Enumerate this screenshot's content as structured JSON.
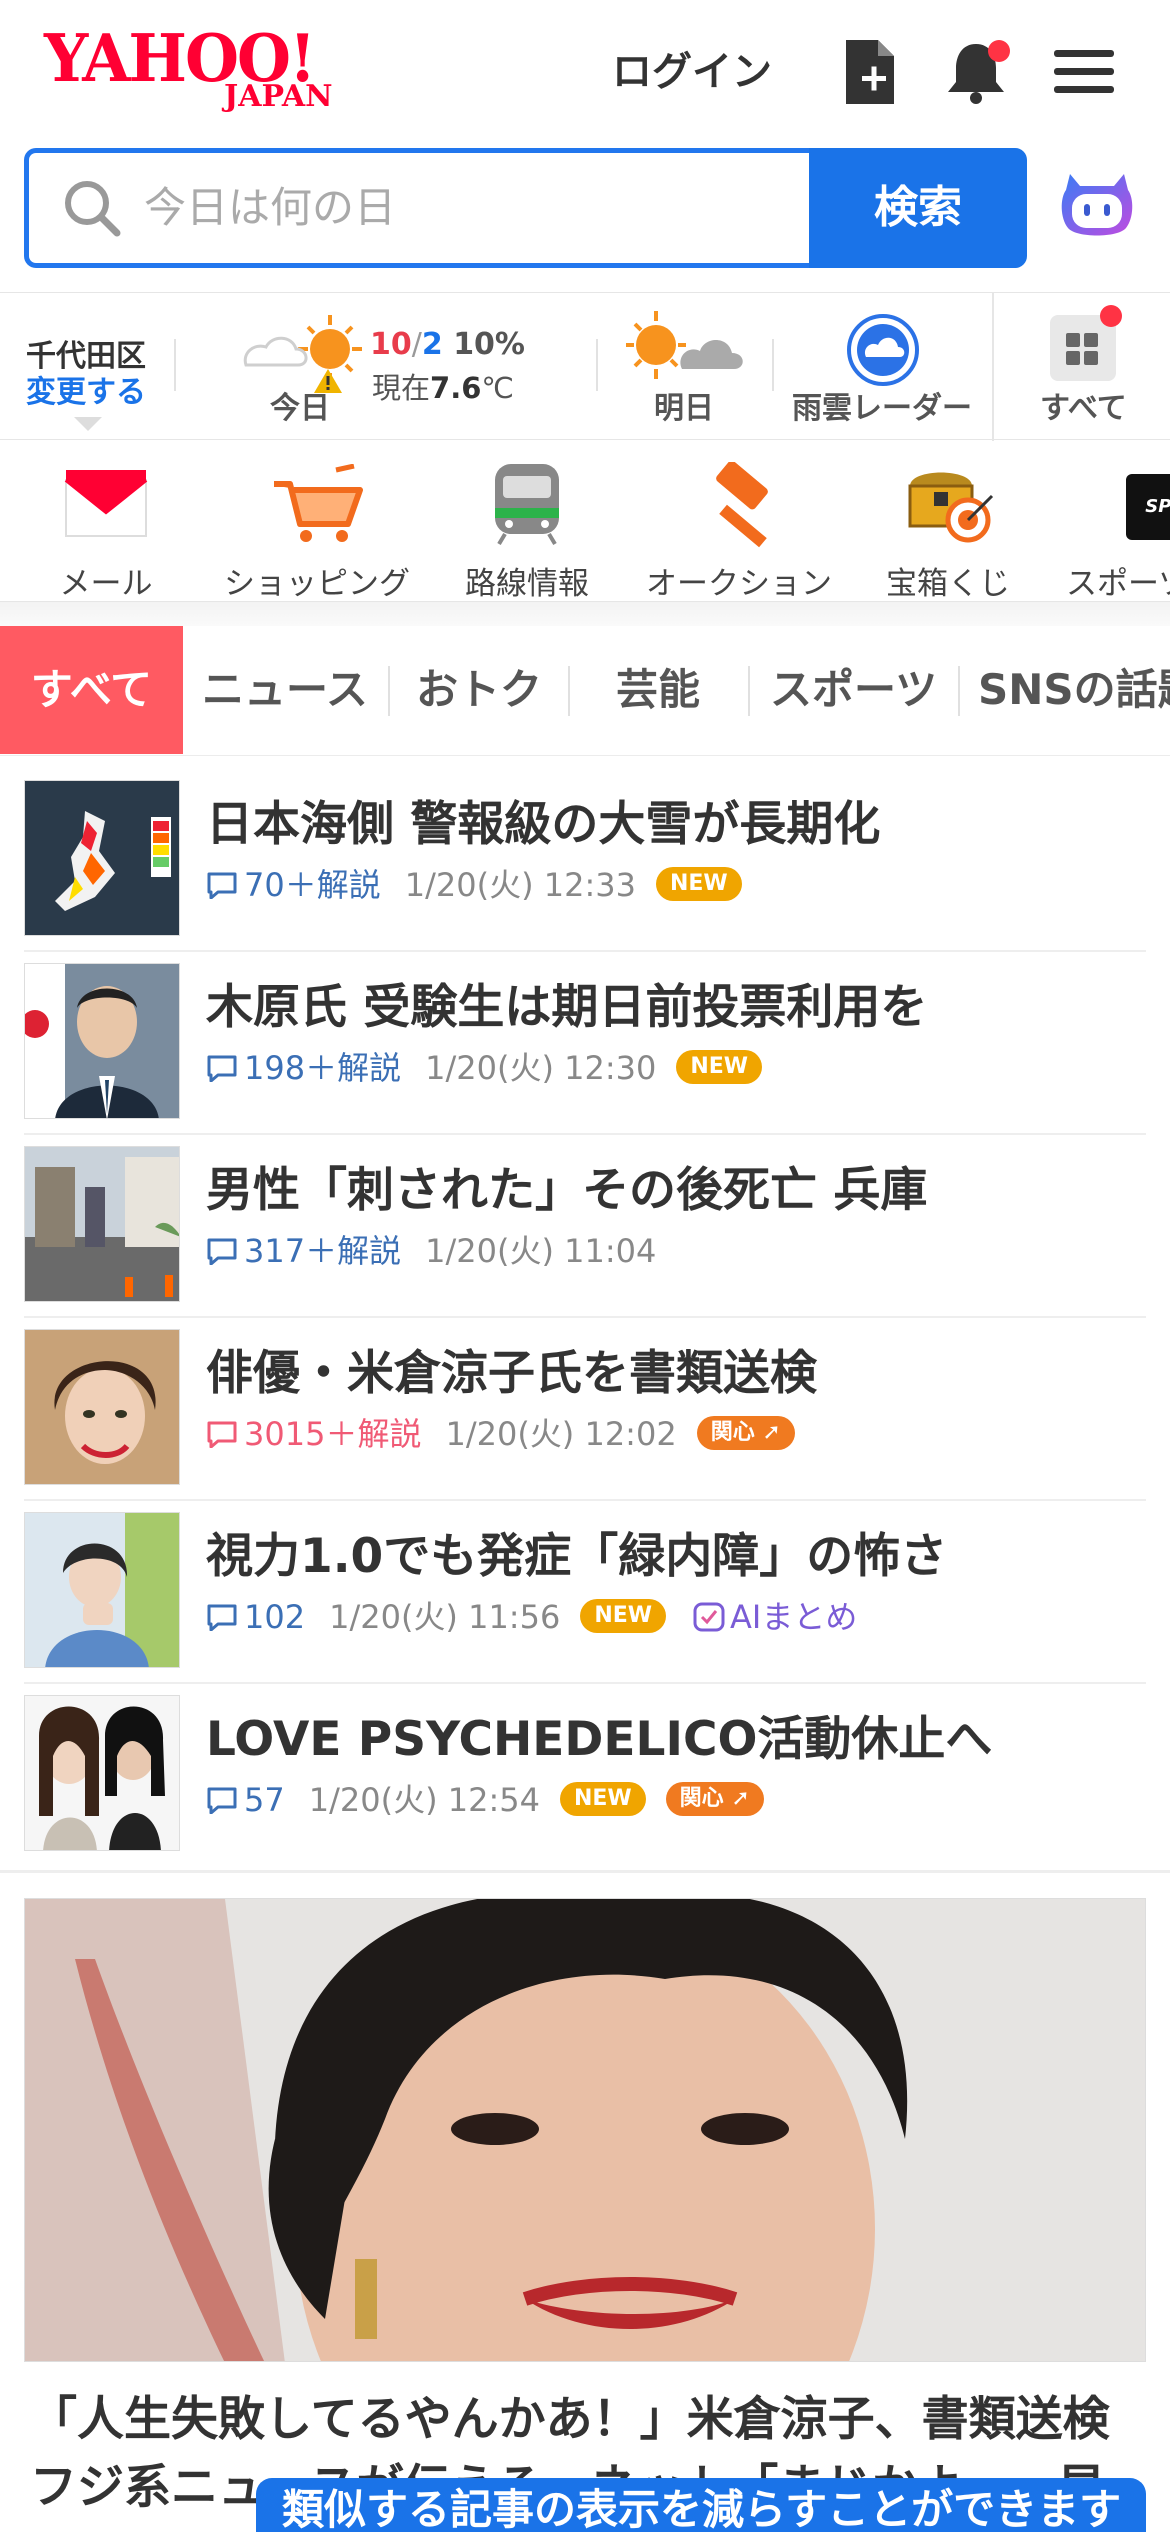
{
  "header": {
    "logo_main": "YAHOO!",
    "logo_sub": "JAPAN",
    "login_label": "ログイン"
  },
  "search": {
    "placeholder": "今日は何の日",
    "button_label": "検索"
  },
  "weather": {
    "location": "千代田区",
    "change_label": "変更する",
    "today_label": "今日",
    "temp_high": "10",
    "temp_sep": "/",
    "temp_low": "2",
    "precip": "10%",
    "now_prefix": "現在",
    "now_temp": "7.6",
    "now_unit": "℃",
    "tomorrow_label": "明日",
    "radar_label": "雨雲レーダー",
    "all_label": "すべて"
  },
  "services": [
    {
      "label": "メール",
      "icon": "mail-icon"
    },
    {
      "label": "ショッピング",
      "icon": "cart-icon"
    },
    {
      "label": "路線情報",
      "icon": "train-icon"
    },
    {
      "label": "オークション",
      "icon": "gavel-icon"
    },
    {
      "label": "宝箱くじ",
      "icon": "treasure-icon"
    },
    {
      "label": "スポーツ",
      "icon": "sports-icon"
    }
  ],
  "tabs": [
    "すべて",
    "ニュース",
    "おトク",
    "芸能",
    "スポーツ",
    "SNSの話題"
  ],
  "news": [
    {
      "title": "日本海側 警報級の大雪が長期化",
      "comments": "70",
      "kaisetsu": "＋解説",
      "time": "1/20(火) 12:33",
      "badge": "NEW"
    },
    {
      "title": "木原氏 受験生は期日前投票利用を",
      "comments": "198",
      "kaisetsu": "＋解説",
      "time": "1/20(火) 12:30",
      "badge": "NEW"
    },
    {
      "title": "男性「刺された」その後死亡 兵庫",
      "comments": "317",
      "kaisetsu": "＋解説",
      "time": "1/20(火) 11:04"
    },
    {
      "title": "俳優・米倉涼子氏を書類送検",
      "comments": "3015",
      "kaisetsu": "＋解説",
      "time": "1/20(火) 12:02",
      "badge2": "関心"
    },
    {
      "title": "視力1.0でも発症「緑内障」の怖さ",
      "comments": "102",
      "time": "1/20(火) 11:56",
      "badge": "NEW",
      "ai": "AIまとめ"
    },
    {
      "title": "LOVE PSYCHEDELICO活動休止へ",
      "comments": "57",
      "time": "1/20(火) 12:54",
      "badge": "NEW",
      "badge2": "関心"
    }
  ],
  "feature": {
    "title": "「人生失敗してるやんかあ！」米倉涼子、書類送検",
    "subtitle": "フジ系ニュースが伝える　ネット「まじかよ…　早"
  },
  "toast": "類似する記事の表示を減らすことができます"
}
